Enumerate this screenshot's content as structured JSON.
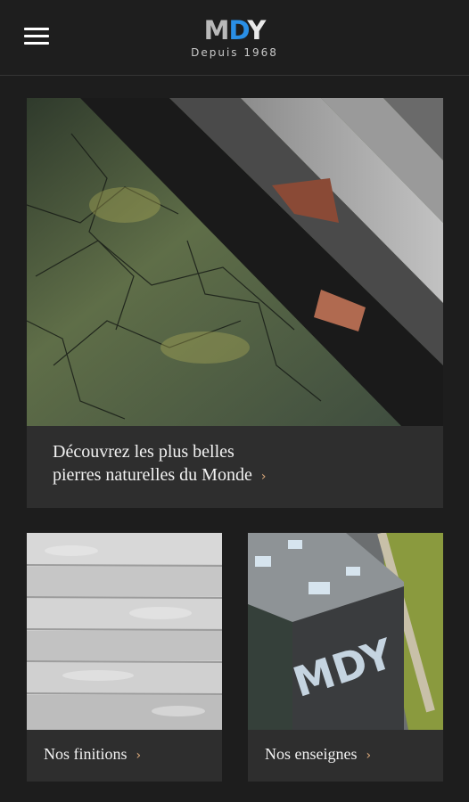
{
  "header": {
    "logo": {
      "m": "M",
      "d": "D",
      "y": "Y"
    },
    "tagline": "Depuis 1968"
  },
  "hero": {
    "line1": "Découvrez les plus belles",
    "line2": "pierres naturelles du Monde",
    "chevron": "›"
  },
  "cards": [
    {
      "label": "Nos finitions",
      "chevron": "›"
    },
    {
      "label": "Nos enseignes",
      "chevron": "›"
    }
  ],
  "building_sign": "MDY",
  "colors": {
    "background": "#1d1d1d",
    "accent_blue": "#2a8fe6",
    "chevron": "#d9a87a",
    "card": "#2e2e2e"
  }
}
